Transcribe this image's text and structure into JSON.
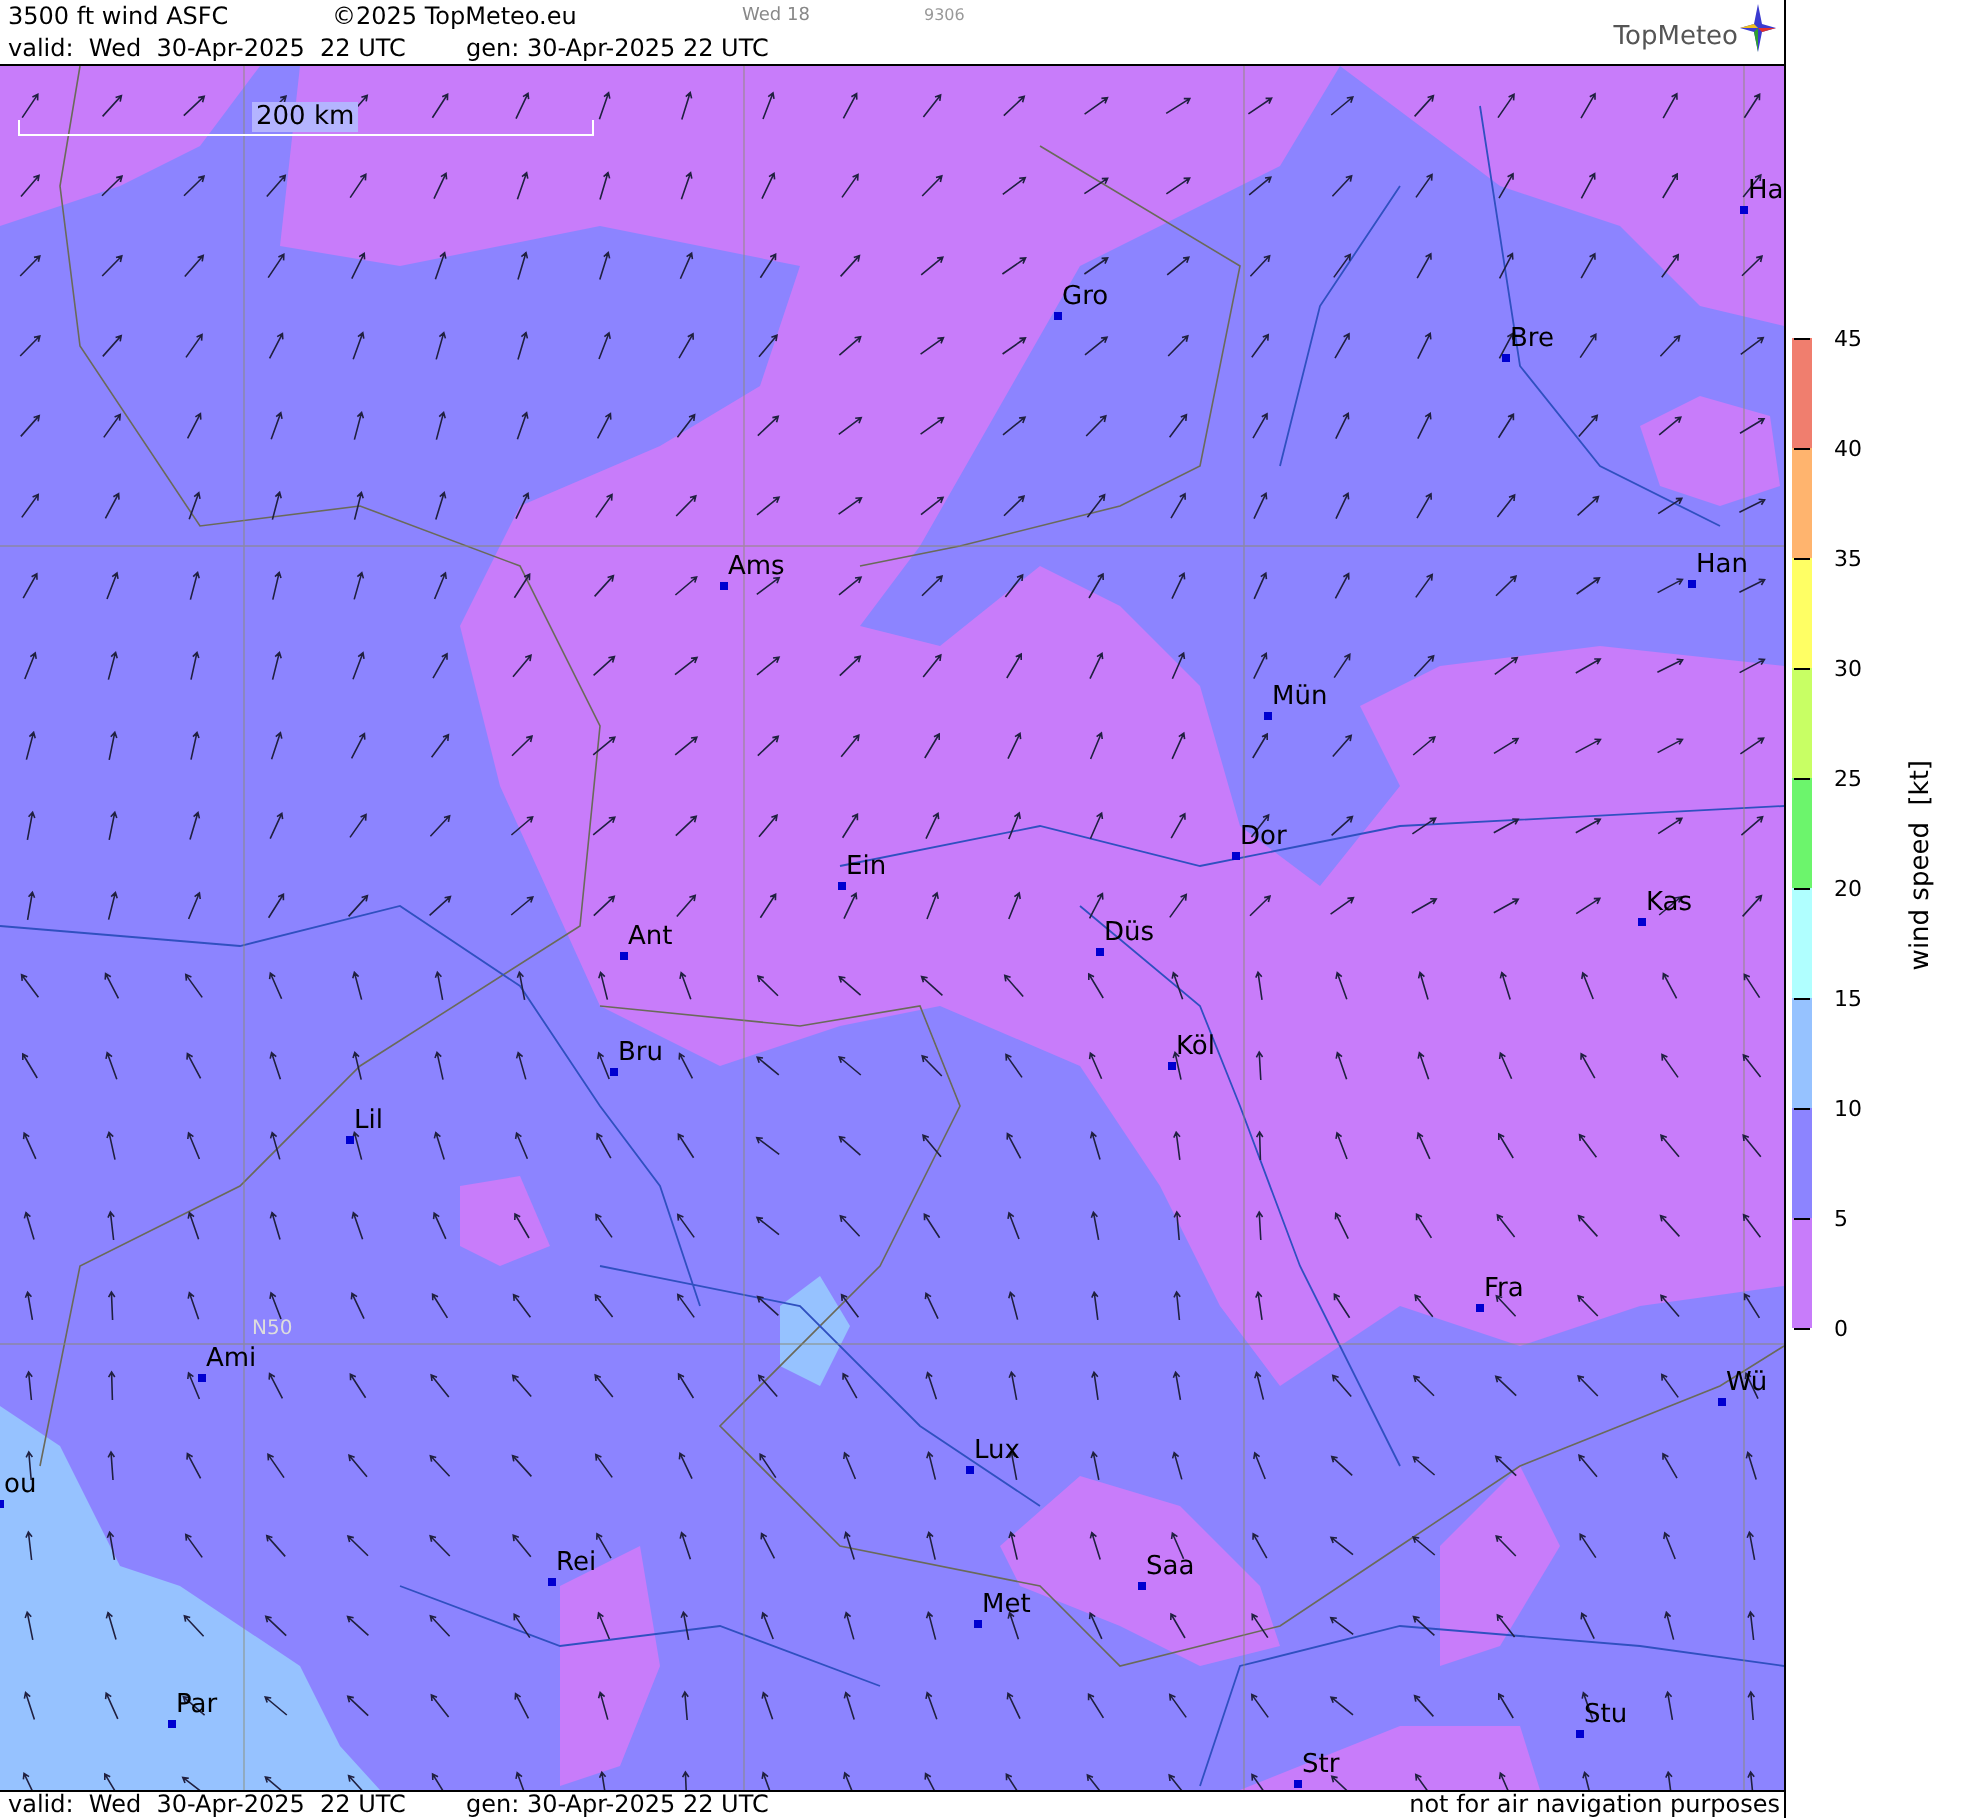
{
  "header": {
    "title": "3500 ft wind ASFC",
    "copyright": "©2025 TopMeteo.eu",
    "day": "Wed 18",
    "code": "9306",
    "valid": "valid:  Wed  30-Apr-2025  22 UTC",
    "generated": "gen: 30-Apr-2025 22 UTC",
    "logo": "TopMeteo"
  },
  "map": {
    "scale": "200 km",
    "grid_label": "N50",
    "cities": [
      {
        "name": "Ha"
      },
      {
        "name": "Gro"
      },
      {
        "name": "Bre"
      },
      {
        "name": "Ams"
      },
      {
        "name": "Han"
      },
      {
        "name": "Mün"
      },
      {
        "name": "Dor"
      },
      {
        "name": "Ein"
      },
      {
        "name": "Kas"
      },
      {
        "name": "Ant"
      },
      {
        "name": "Düs"
      },
      {
        "name": "Köl"
      },
      {
        "name": "Bru"
      },
      {
        "name": "Lil"
      },
      {
        "name": "Fra"
      },
      {
        "name": "Ami"
      },
      {
        "name": "Wü"
      },
      {
        "name": "Lux"
      },
      {
        "name": "ou"
      },
      {
        "name": "Saa"
      },
      {
        "name": "Rei"
      },
      {
        "name": "Met"
      },
      {
        "name": "Par"
      },
      {
        "name": "Stu"
      },
      {
        "name": "Str"
      }
    ]
  },
  "legend": {
    "title": "wind speed  [kt]",
    "ticks": [
      "45",
      "40",
      "35",
      "30",
      "25",
      "20",
      "15",
      "10",
      "5",
      "0"
    ],
    "bins": [
      {
        "color": "#f07e6e"
      },
      {
        "color": "#ffb46e"
      },
      {
        "color": "#ffff64"
      },
      {
        "color": "#c8ff64"
      },
      {
        "color": "#6cf56c"
      },
      {
        "color": "#b0ffff"
      },
      {
        "color": "#96c2ff"
      },
      {
        "color": "#8c84ff"
      },
      {
        "color": "#c87cfa"
      }
    ]
  },
  "footer": {
    "valid": "valid:  Wed  30-Apr-2025  22 UTC",
    "generated": "gen: 30-Apr-2025 22 UTC",
    "disclaimer": "not for air navigation purposes"
  }
}
